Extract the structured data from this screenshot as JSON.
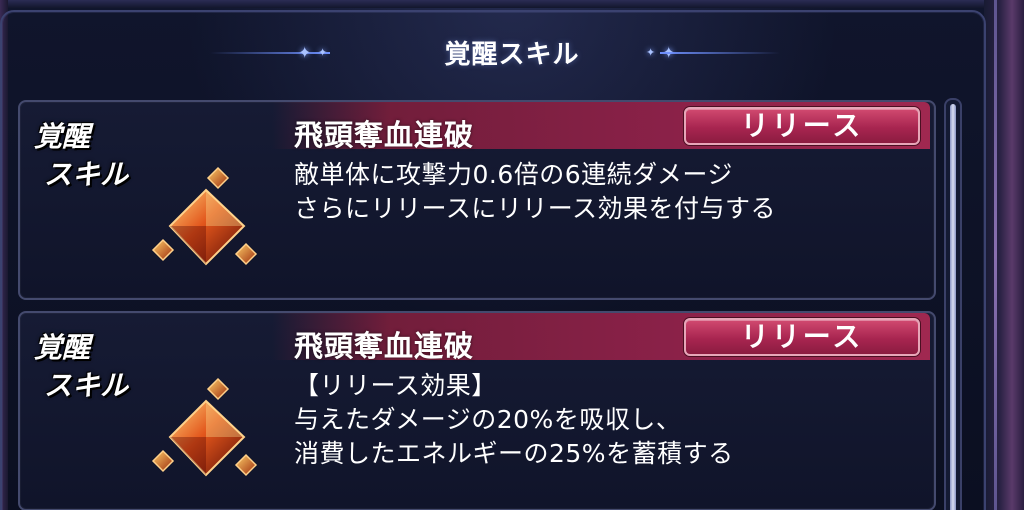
{
  "header": {
    "title": "覚醒スキル"
  },
  "skills": [
    {
      "badge_line1": "覚醒",
      "badge_line2": "スキル",
      "name": "飛頭奪血連破",
      "release_button": "リリース",
      "icon": "fire-crystal-icon",
      "description": [
        "敵単体に攻撃力0.6倍の6連続ダメージ",
        "さらにリリースにリリース効果を付与する"
      ]
    },
    {
      "badge_line1": "覚醒",
      "badge_line2": "スキル",
      "name": "飛頭奪血連破",
      "release_button": "リリース",
      "icon": "fire-crystal-icon",
      "description": [
        "【リリース効果】",
        "与えたダメージの20%を吸収し、",
        "消費したエネルギーの25%を蓄積する"
      ]
    }
  ],
  "colors": {
    "accent_band": "#8a2148",
    "button": "#a82550",
    "gem": "#e2561c"
  }
}
